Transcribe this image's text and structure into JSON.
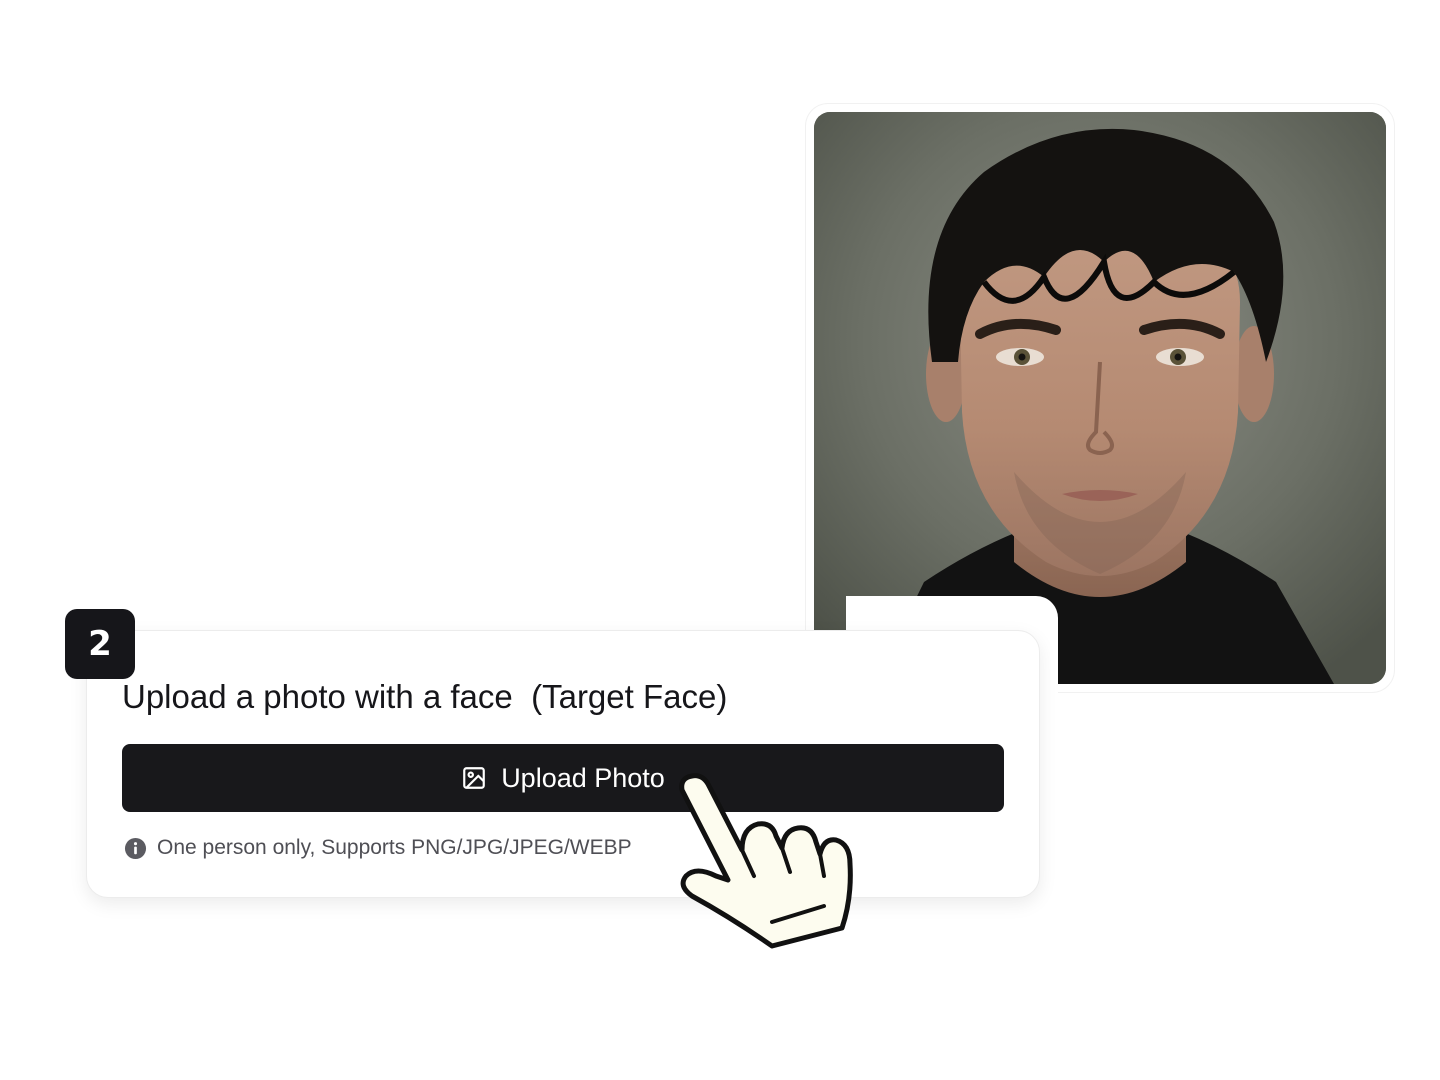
{
  "step": {
    "number": "2"
  },
  "card": {
    "title": "Upload a photo with a face  (Target Face)",
    "upload_button_label": "Upload Photo",
    "hint_text": "One person only, Supports PNG/JPG/JPEG/WEBP"
  },
  "icons": {
    "upload": "image-icon",
    "hint": "info-icon",
    "cursor": "pointer-hand-icon"
  },
  "colors": {
    "button_bg": "#18181b",
    "badge_bg": "#16161a",
    "text": "#16161a",
    "hint_text": "#4f4f55"
  }
}
